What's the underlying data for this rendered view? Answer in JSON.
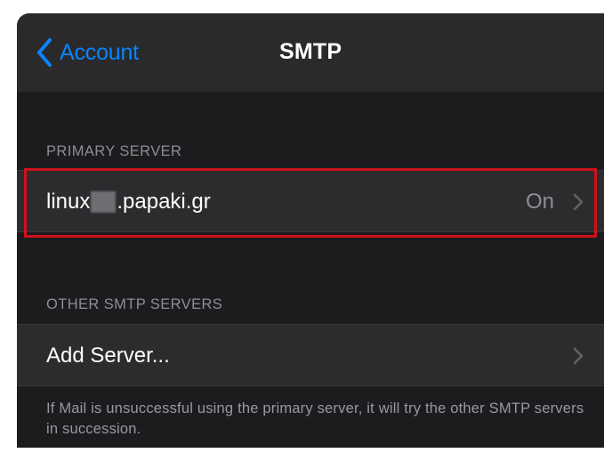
{
  "navbar": {
    "back_label": "Account",
    "title": "SMTP"
  },
  "primary_section": {
    "header": "PRIMARY SERVER",
    "server": {
      "name_prefix": "linux",
      "name_suffix": ".papaki.gr",
      "value": "On"
    }
  },
  "other_section": {
    "header": "OTHER SMTP SERVERS",
    "add_server_label": "Add Server...",
    "footer": "If Mail is unsuccessful using the primary server, it will try the other SMTP servers in succession."
  },
  "colors": {
    "accent": "#0a84ff",
    "background": "#1c1c1e",
    "cell": "#2c2c2e",
    "highlight": "#d0111b"
  },
  "icons": {
    "back": "chevron-left-icon",
    "disclosure": "chevron-right-icon"
  }
}
